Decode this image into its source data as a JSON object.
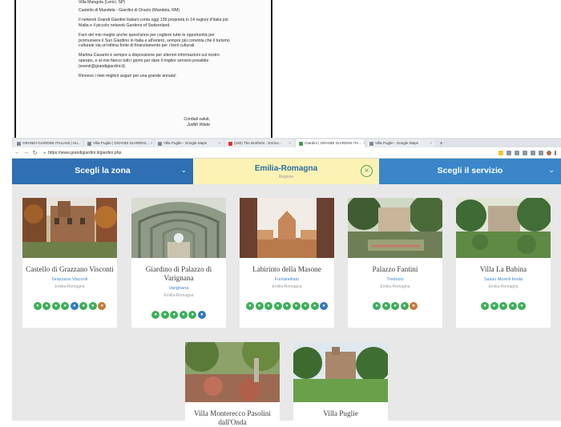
{
  "letter": {
    "lines_top": [
      "Villa Mangola (Lerici, SP)",
      "Castello di Mandela - Giardini di Orazio (Mandela, RM)"
    ],
    "p1": "Il network Grandi Giardini Italiani conta oggi 136 proprietà in 14 regioni d'Italia più Malta e il piccolo network Gardens of Switzerland.",
    "p2": "Farò del mio meglio anche quest'anno per cogliere tutte le opportunità per promuovere il Suo Giardino in Italia e all'estero, sempre più convinta che il turismo culturale sia un'ottima fonte di finanziamento per i beni culturali.",
    "p3": "Martina Casarini è sempre a disposizione per ulteriori informazioni sul nostro operato, e al mio fianco tutti i giorni per dare il miglior servizio possibile (eventi@grandigiardini.it).",
    "p4": "Rinnovo i miei migliori auguri per una grande annata!",
    "closing": "Cordiali saluti,",
    "signature": "Judith Wade"
  },
  "browser": {
    "tabs": [
      {
        "label": "GRANDI GIARDINI ITALIANI | Ho..."
      },
      {
        "label": "Villa Puglie | GRANDI GIARDINI..."
      },
      {
        "label": "Villa Puglie - Google Maps"
      },
      {
        "label": "(182) The Brothers - Enrico..."
      },
      {
        "label": "Giardini | GRANDI GIARDINI ITA..."
      },
      {
        "label": "Villa Puglie - Google Maps"
      }
    ],
    "active_tab": 4,
    "url": "https://www.grandigiardini.it/giardini.php"
  },
  "filters": {
    "zone_label": "Scegli la zona",
    "region_label": "Emilia-Romagna",
    "region_sub": "Regione",
    "service_label": "Scegli il servizio"
  },
  "cards": [
    {
      "title": "Castello di Grazzano Visconti",
      "location": "Grazzano Visconti",
      "region": "Emilia-Romagna",
      "services": [
        "g",
        "g",
        "g",
        "g",
        "b",
        "g",
        "g",
        "o"
      ]
    },
    {
      "title": "Giardino di Palazzo di Varignana",
      "location": "Varignana",
      "region": "Emilia-Romagna",
      "services": [
        "g",
        "g",
        "g",
        "g",
        "g",
        "b"
      ]
    },
    {
      "title": "Labirinto della Masone",
      "location": "Fontanellato",
      "region": "Emilia-Romagna",
      "services": [
        "g",
        "g",
        "g",
        "g",
        "g",
        "g",
        "g",
        "g",
        "b"
      ]
    },
    {
      "title": "Palazzo Fantini",
      "location": "Tredozio",
      "region": "Emilia-Romagna",
      "services": [
        "g",
        "g",
        "g",
        "g",
        "o"
      ]
    },
    {
      "title": "Villa La Babina",
      "location": "Sasso Morelli Imola",
      "region": "Emilia-Romagna",
      "services": [
        "g",
        "g",
        "g",
        "g",
        "g"
      ]
    },
    {
      "title": "Villa Monterecco Pasolini dall'Onda",
      "location": "",
      "region": "",
      "services": []
    },
    {
      "title": "Villa Puglie",
      "location": "",
      "region": "",
      "services": []
    }
  ],
  "colors": {
    "zone_bg": "#2f6fb3",
    "region_bg": "#fbf2b4",
    "service_bg": "#3a86c8",
    "service_green": "#3fae5b",
    "service_blue": "#3478c0",
    "service_orange": "#c8773a"
  }
}
